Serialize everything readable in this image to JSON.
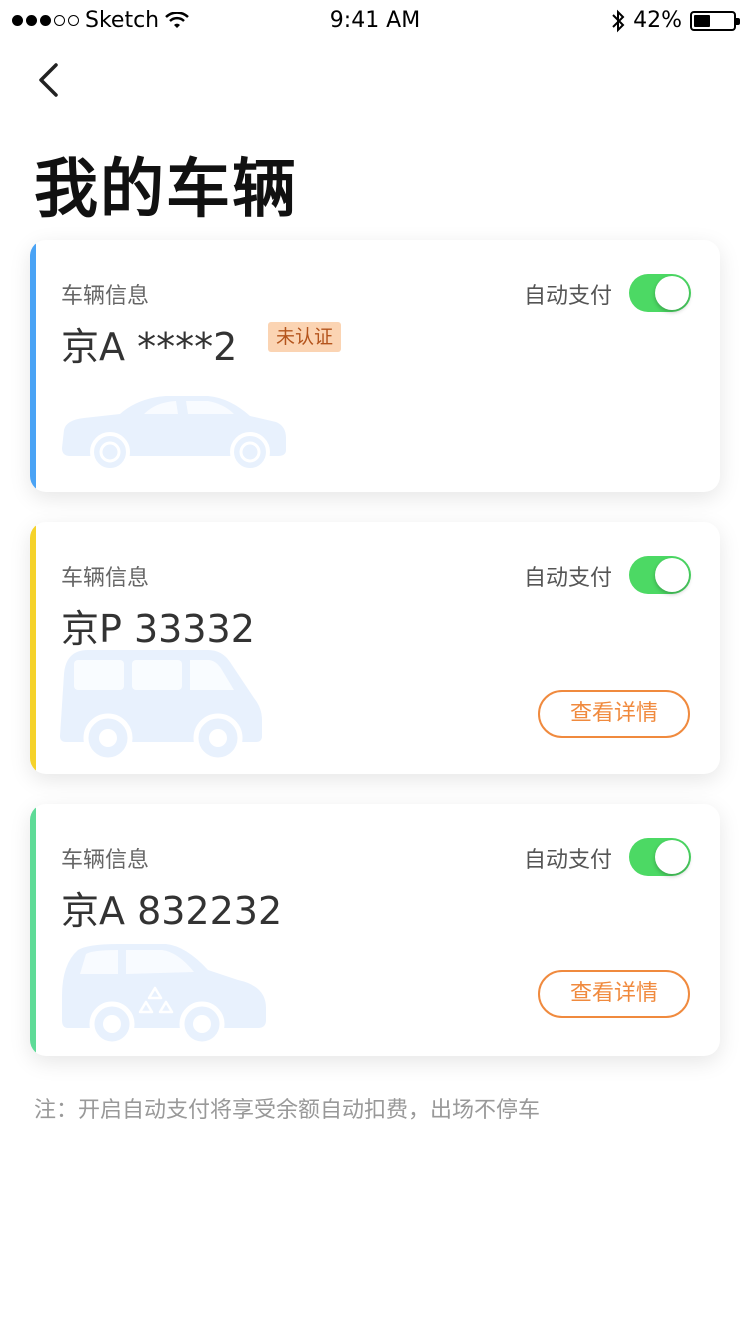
{
  "status_bar": {
    "carrier": "Sketch",
    "time": "9:41 AM",
    "battery": "42%",
    "battery_level": 0.42,
    "signal_bars_filled": 3,
    "signal_bars_total": 5
  },
  "nav": {
    "back_icon": "chevron-left-icon"
  },
  "page": {
    "title": "我的车辆"
  },
  "vehicles": [
    {
      "label": "车辆信息",
      "plate": "京A ****2",
      "badge": "未认证",
      "autopay_label": "自动支付",
      "autopay_on": true,
      "accent_color": "#4aa3f5",
      "icon": "sedan-icon",
      "detail_button": null
    },
    {
      "label": "车辆信息",
      "plate": "京P 33332",
      "badge": null,
      "autopay_label": "自动支付",
      "autopay_on": true,
      "accent_color": "#f5d22a",
      "icon": "van-icon",
      "detail_button": "查看详情"
    },
    {
      "label": "车辆信息",
      "plate": "京A 832232",
      "badge": null,
      "autopay_label": "自动支付",
      "autopay_on": true,
      "accent_color": "#5edb97",
      "icon": "eco-car-icon",
      "detail_button": "查看详情"
    }
  ],
  "footnote": "注：开启自动支付将享受余额自动扣费，出场不停车",
  "colors": {
    "toggle_on": "#4cd964",
    "detail_button": "#f08a3e",
    "badge_bg": "#fbd4b3",
    "badge_text": "#b4541c",
    "illustration": "#e8f1fd"
  }
}
